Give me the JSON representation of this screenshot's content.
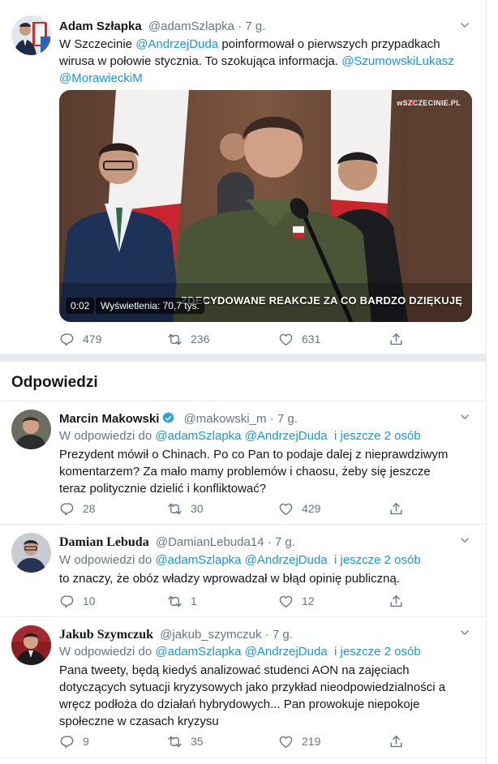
{
  "main_tweet": {
    "author": "Adam Szłapka",
    "handle": "@adamSzlapka",
    "sep": "·",
    "time": "7 g.",
    "text_1": "W Szczecinie ",
    "mention_1": "@AndrzejDuda",
    "text_2": " poinformował o pierwszych przypadkach wirusa w połowie stycznia. To szokująca informacja. ",
    "mention_2": "@SzumowskiLukasz",
    "mention_3": "@MorawieckiM",
    "video": {
      "subtitle": "ZDECYDOWANE REAKCJE ZA CO BARDZO DZIĘKUJĘ",
      "watermark": "wSZCZECINIE.PL",
      "elapsed": "0:02",
      "views": "Wyświetlenia: 70,7 tys."
    },
    "replies": "479",
    "retweets": "236",
    "likes": "631"
  },
  "section_title": "Odpowiedzi",
  "replies": [
    {
      "author": "Marcin Makowski",
      "handle": "@makowski_m",
      "time": "7 g.",
      "reply_prefix": "W odpowiedzi do ",
      "reply_mentions": "@adamSzlapka @AndrzejDuda",
      "reply_more": "i jeszcze 2 osób",
      "text": "Prezydent mówił o Chinach. Po co Pan to podaje dalej z nieprawdziwym komentarzem? Za mało mamy problemów i chaosu, żeby się jeszcze teraz politycznie dzielić i konfliktować?",
      "replies": "28",
      "retweets": "30",
      "likes": "429"
    },
    {
      "author": "Damian Lebuda",
      "handle": "@DamianLebuda14",
      "time": "7 g.",
      "reply_prefix": "W odpowiedzi do ",
      "reply_mentions": "@adamSzlapka @AndrzejDuda",
      "reply_more": "i jeszcze 2 osób",
      "text": "to znaczy, że obóz władzy wprowadzał w błąd opinię publiczną.",
      "replies": "10",
      "retweets": "1",
      "likes": "12"
    },
    {
      "author": "Jakub Szymczuk",
      "handle": "@jakub_szymczuk",
      "time": "7 g.",
      "reply_prefix": "W odpowiedzi do ",
      "reply_mentions": "@adamSzlapka @AndrzejDuda",
      "reply_more": "i jeszcze 2 osób",
      "text": "Pana tweety, będą kiedyś analizować studenci AON na zajęciach dotyczących sytuacji kryzysowych jako przykład nieodpowiedzialności a wręcz podłoża do działań hybrydowych... Pan prowokuje niepokoje społeczne w czasach kryzysu",
      "replies": "9",
      "retweets": "35",
      "likes": "219"
    }
  ],
  "colors": {
    "link": "#1b95e0",
    "muted": "#657786",
    "divider": "#e6ecf0",
    "verified": "#1da1f2"
  }
}
